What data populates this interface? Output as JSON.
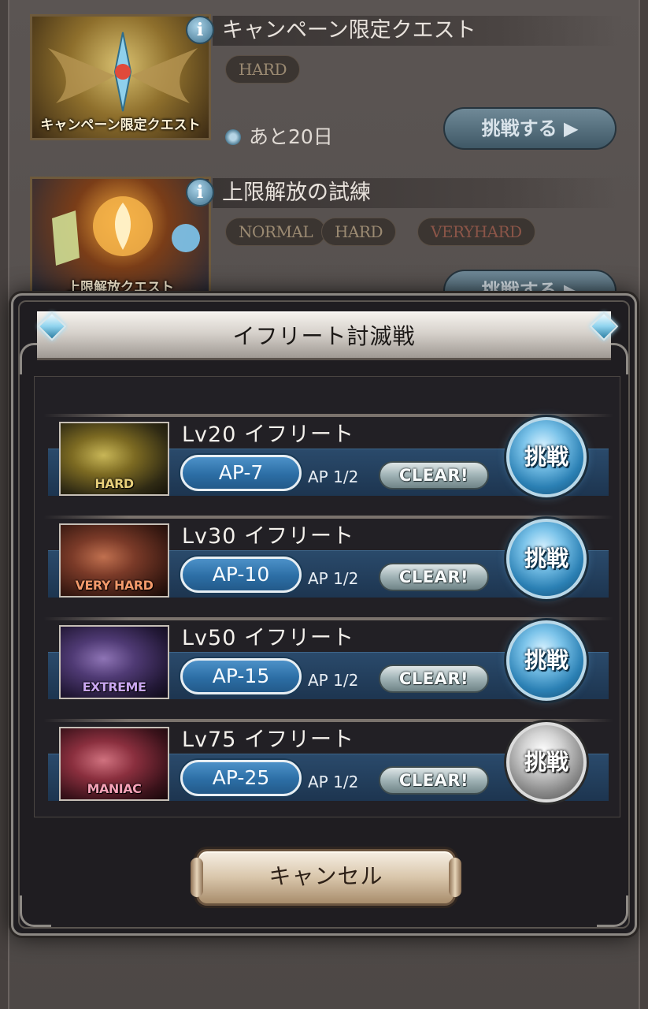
{
  "background_quests": [
    {
      "title": "キャンペーン限定クエスト",
      "thumb_caption": "キャンペーン限定クエスト",
      "difficulties": [
        "HARD"
      ],
      "remaining": "あと20日",
      "challenge_label": "挑戦する ▶"
    },
    {
      "title": "上限解放の試練",
      "thumb_caption": "上限解放クエスト",
      "difficulties": [
        "NORMAL",
        "HARD",
        "VERYHARD"
      ],
      "challenge_label": "挑戦する ▶"
    }
  ],
  "modal": {
    "title": "イフリート討滅戦",
    "cancel_label": "キャンセル",
    "battles": [
      {
        "name": "Lv20 イフリート",
        "difficulty": "HARD",
        "difficulty_color": "#e7cf7a",
        "ap": "AP-7",
        "ap_count": "AP 1/2",
        "clear": "CLEAR!",
        "challenge": "挑戦",
        "challenge_state": "available"
      },
      {
        "name": "Lv30 イフリート",
        "difficulty": "VERY HARD",
        "difficulty_color": "#f39a6b",
        "ap": "AP-10",
        "ap_count": "AP 1/2",
        "clear": "CLEAR!",
        "challenge": "挑戦",
        "challenge_state": "available"
      },
      {
        "name": "Lv50 イフリート",
        "difficulty": "EXTREME",
        "difficulty_color": "#c9a6f0",
        "ap": "AP-15",
        "ap_count": "AP 1/2",
        "clear": "CLEAR!",
        "challenge": "挑戦",
        "challenge_state": "available"
      },
      {
        "name": "Lv75 イフリート",
        "difficulty": "MANIAC",
        "difficulty_color": "#f7a3b8",
        "ap": "AP-25",
        "ap_count": "AP 1/2",
        "clear": "CLEAR!",
        "challenge": "挑戦",
        "challenge_state": "locked"
      }
    ]
  },
  "colors": {
    "hard": "#a7912f",
    "very_hard": "#8a3d2b",
    "extreme": "#4d3570",
    "maniac": "#8f2f3f"
  }
}
